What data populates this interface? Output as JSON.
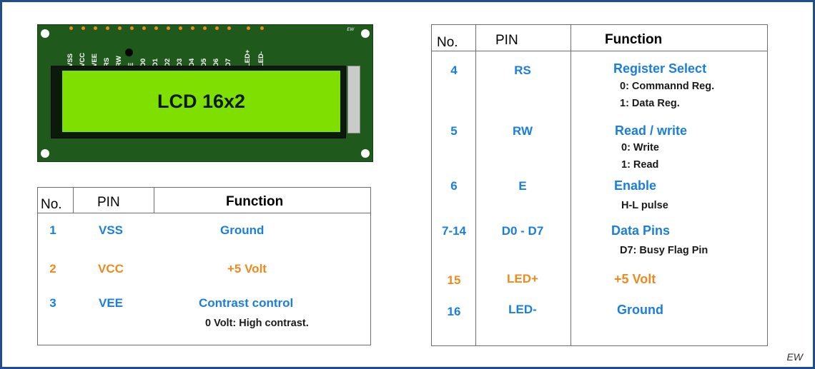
{
  "colors": {
    "blue": "#1a7fdc",
    "orange": "#ee8a1c",
    "frame": "#1f4e8c"
  },
  "lcd": {
    "screen_text": "LCD 16x2",
    "board_mark": "EW",
    "pins": [
      "VSS",
      "VCC",
      "VEE",
      "RS",
      "RW",
      "E",
      "D0",
      "D1",
      "D2",
      "D3",
      "D4",
      "D5",
      "D6",
      "D7",
      "LED+",
      "LED-"
    ]
  },
  "table_left": {
    "headers": {
      "no": "No.",
      "pin": "PIN",
      "function": "Function"
    },
    "rows": [
      {
        "no": "1",
        "pin": "VSS",
        "function": "Ground",
        "color": "blue",
        "notes": []
      },
      {
        "no": "2",
        "pin": "VCC",
        "function": "+5 Volt",
        "color": "orange",
        "notes": []
      },
      {
        "no": "3",
        "pin": "VEE",
        "function": "Contrast control",
        "color": "blue",
        "notes": [
          "0 Volt: High contrast."
        ]
      }
    ]
  },
  "table_right": {
    "headers": {
      "no": "No.",
      "pin": "PIN",
      "function": "Function"
    },
    "rows": [
      {
        "no": "4",
        "pin": "RS",
        "function": "Register Select",
        "color": "blue",
        "notes": [
          "0: Commannd Reg.",
          "1:  Data Reg."
        ]
      },
      {
        "no": "5",
        "pin": "RW",
        "function": "Read / write",
        "color": "blue",
        "notes": [
          "0: Write",
          "1:  Read"
        ]
      },
      {
        "no": "6",
        "pin": "E",
        "function": "Enable",
        "color": "blue",
        "notes": [
          "H-L pulse"
        ]
      },
      {
        "no": "7-14",
        "pin": "D0 - D7",
        "function": "Data Pins",
        "color": "blue",
        "notes": [
          "D7:  Busy Flag Pin"
        ]
      },
      {
        "no": "15",
        "pin": "LED+",
        "function": "+5 Volt",
        "color": "orange",
        "notes": []
      },
      {
        "no": "16",
        "pin": "LED-",
        "function": "Ground",
        "color": "blue",
        "notes": []
      }
    ]
  },
  "watermark": "EW"
}
